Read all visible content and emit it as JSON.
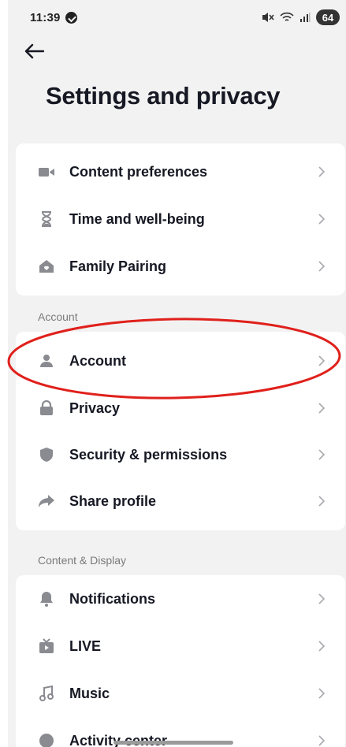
{
  "status_bar": {
    "time": "11:39",
    "battery": "64"
  },
  "header": {
    "title": "Settings and privacy"
  },
  "groups": [
    {
      "section_label": "",
      "items": [
        {
          "label": "Content preferences",
          "icon": "video-camera-icon"
        },
        {
          "label": "Time and well-being",
          "icon": "hourglass-icon"
        },
        {
          "label": "Family Pairing",
          "icon": "house-heart-icon"
        }
      ]
    },
    {
      "section_label": "Account",
      "items": [
        {
          "label": "Account",
          "icon": "person-icon"
        },
        {
          "label": "Privacy",
          "icon": "lock-icon"
        },
        {
          "label": "Security & permissions",
          "icon": "shield-icon"
        },
        {
          "label": "Share profile",
          "icon": "share-arrow-icon"
        }
      ]
    },
    {
      "section_label": "Content & Display",
      "items": [
        {
          "label": "Notifications",
          "icon": "bell-icon"
        },
        {
          "label": "LIVE",
          "icon": "tv-icon"
        },
        {
          "label": "Music",
          "icon": "music-note-icon"
        },
        {
          "label": "Activity center",
          "icon": "activity-icon"
        }
      ]
    }
  ],
  "colors": {
    "background": "#f2f2f2",
    "card": "#ffffff",
    "text": "#161823",
    "icon": "#8a8b91",
    "chevron": "#a9a9ae",
    "annotation": "#e0201b"
  }
}
